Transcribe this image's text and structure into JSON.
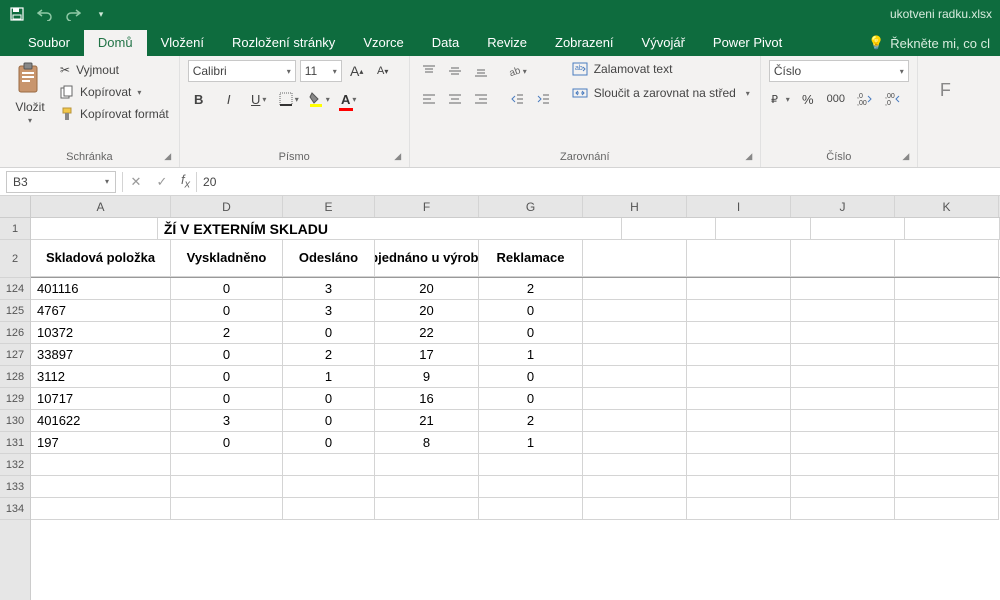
{
  "filename": "ukotveni radku.xlsx",
  "tabs": [
    "Soubor",
    "Domů",
    "Vložení",
    "Rozložení stránky",
    "Vzorce",
    "Data",
    "Revize",
    "Zobrazení",
    "Vývojář",
    "Power Pivot"
  ],
  "activeTab": "Domů",
  "tellme": "Řekněte mi, co cl",
  "clipboard": {
    "paste": "Vložit",
    "cut": "Vyjmout",
    "copy": "Kopírovat",
    "fmt": "Kopírovat formát",
    "label": "Schránka"
  },
  "font": {
    "name": "Calibri",
    "size": "11",
    "label": "Písmo"
  },
  "align": {
    "wrap": "Zalamovat text",
    "merge": "Sloučit a zarovnat na střed",
    "label": "Zarovnání"
  },
  "number": {
    "fmt": "Číslo",
    "label": "Číslo"
  },
  "namebox": "B3",
  "formula": "20",
  "columns": [
    "A",
    "D",
    "E",
    "F",
    "G",
    "H",
    "I",
    "J",
    "K"
  ],
  "titleRow": "ŽÍ V EXTERNÍM SKLADU",
  "headers": [
    "Skladová položka",
    "Vyskladněno",
    "Odesláno",
    "Objednáno u výrobce",
    "Reklamace"
  ],
  "frozenRows": [
    "1",
    "2"
  ],
  "rowNums": [
    "124",
    "125",
    "126",
    "127",
    "128",
    "129",
    "130",
    "131",
    "132",
    "133",
    "134"
  ],
  "chart_data": {
    "type": "table",
    "columns": [
      "Skladová položka",
      "Vyskladněno",
      "Odesláno",
      "Objednáno u výrobce",
      "Reklamace"
    ],
    "rows": [
      [
        "401116",
        0,
        3,
        20,
        2
      ],
      [
        "4767",
        0,
        3,
        20,
        0
      ],
      [
        "10372",
        2,
        0,
        22,
        0
      ],
      [
        "33897",
        0,
        2,
        17,
        1
      ],
      [
        "3112",
        0,
        1,
        9,
        0
      ],
      [
        "10717",
        0,
        0,
        16,
        0
      ],
      [
        "401622",
        3,
        0,
        21,
        2
      ],
      [
        "197",
        0,
        0,
        8,
        1
      ]
    ]
  }
}
